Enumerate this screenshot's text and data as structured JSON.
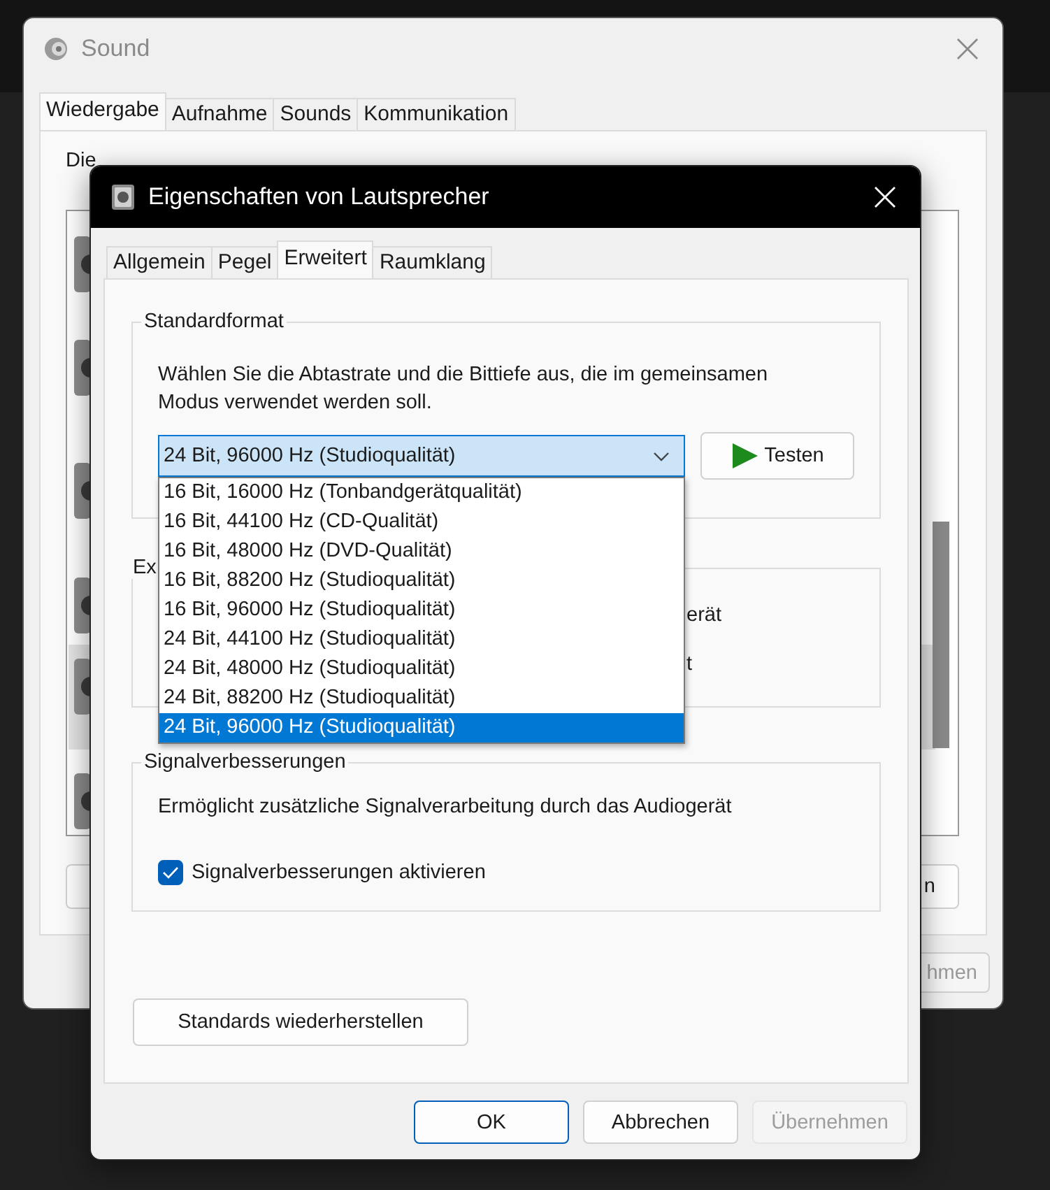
{
  "background_window": {
    "title": "Sound",
    "tabs": [
      {
        "label": "Wiedergabe",
        "selected": true
      },
      {
        "label": "Aufnahme",
        "selected": false
      },
      {
        "label": "Sounds",
        "selected": false
      },
      {
        "label": "Kommunikation",
        "selected": false
      }
    ],
    "description": "Die",
    "buttons": [
      {
        "label": "n"
      }
    ],
    "footer_buttons": [
      {
        "label": "hmen"
      }
    ]
  },
  "dialog": {
    "title": "Eigenschaften von Lautsprecher",
    "tabs": [
      {
        "label": "Allgemein",
        "selected": false
      },
      {
        "label": "Pegel",
        "selected": false
      },
      {
        "label": "Erweitert",
        "selected": true
      },
      {
        "label": "Raumklang",
        "selected": false
      }
    ],
    "default_format": {
      "label": "Standardformat",
      "description": "Wählen Sie die Abtastrate und die Bittiefe aus, die im gemeinsamen Modus verwendet werden soll.",
      "combo": {
        "value": "24 Bit, 96000 Hz (Studioqualität)",
        "expanded": true,
        "options": [
          {
            "label": "16 Bit, 16000 Hz (Tonbandgerätqualität)",
            "selected": false
          },
          {
            "label": "16 Bit, 44100 Hz (CD-Qualität)",
            "selected": false
          },
          {
            "label": "16 Bit, 48000 Hz (DVD-Qualität)",
            "selected": false
          },
          {
            "label": "16 Bit, 88200 Hz (Studioqualität)",
            "selected": false
          },
          {
            "label": "16 Bit, 96000 Hz (Studioqualität)",
            "selected": false
          },
          {
            "label": "24 Bit, 44100 Hz (Studioqualität)",
            "selected": false
          },
          {
            "label": "24 Bit, 48000 Hz (Studioqualität)",
            "selected": false
          },
          {
            "label": "24 Bit, 88200 Hz (Studioqualität)",
            "selected": false
          },
          {
            "label": "24 Bit, 96000 Hz (Studioqualität)",
            "selected": true
          }
        ]
      },
      "test_button": "Testen"
    },
    "exclusive_mode": {
      "label": "Ex",
      "lines": [
        "erät",
        "t"
      ]
    },
    "enhancements": {
      "label": "Signalverbesserungen",
      "description": "Ermöglicht zusätzliche Signalverarbeitung durch das Audiogerät",
      "checkbox": {
        "label": "Signalverbesserungen aktivieren",
        "checked": true
      }
    },
    "restore_button": "Standards wiederherstellen",
    "buttons": [
      {
        "label": "OK",
        "kind": "default",
        "disabled": false
      },
      {
        "label": "Abbrechen",
        "kind": "normal",
        "disabled": false
      },
      {
        "label": "Übernehmen",
        "kind": "normal",
        "disabled": true
      }
    ]
  }
}
